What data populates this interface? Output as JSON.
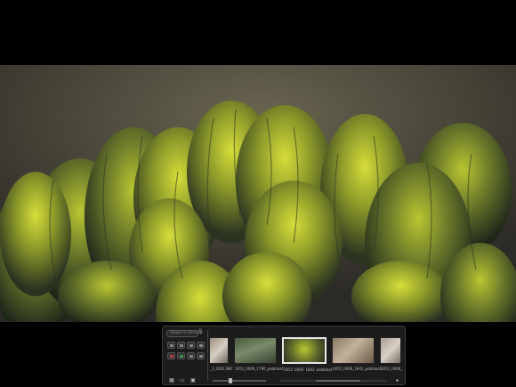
{
  "viewer": {
    "photo_subject": "green seaweed clumps"
  },
  "hud": {
    "search_placeholder": "Viewer in Filmstrip",
    "thumbnails": [
      {
        "caption": "_1_0001.NEF",
        "selected": false
      },
      {
        "caption": "1652_0006_1790_pebbles4",
        "selected": false
      },
      {
        "caption": "1652_0006_1802_pebbles4",
        "selected": true
      },
      {
        "caption": "1652_0006_1841_pebbles4",
        "selected": false
      },
      {
        "caption": "1652_0006_",
        "selected": false
      }
    ],
    "zoom_level": 0.35,
    "colors": {
      "panel": "#1c1c1c",
      "selected_border": "#e8e8e8",
      "flag_red": "#c04040",
      "flag_green": "#40a050"
    },
    "icons": [
      "search-icon",
      "grid-icon",
      "browser-icon",
      "viewer-icon",
      "scroll-right-icon"
    ]
  }
}
